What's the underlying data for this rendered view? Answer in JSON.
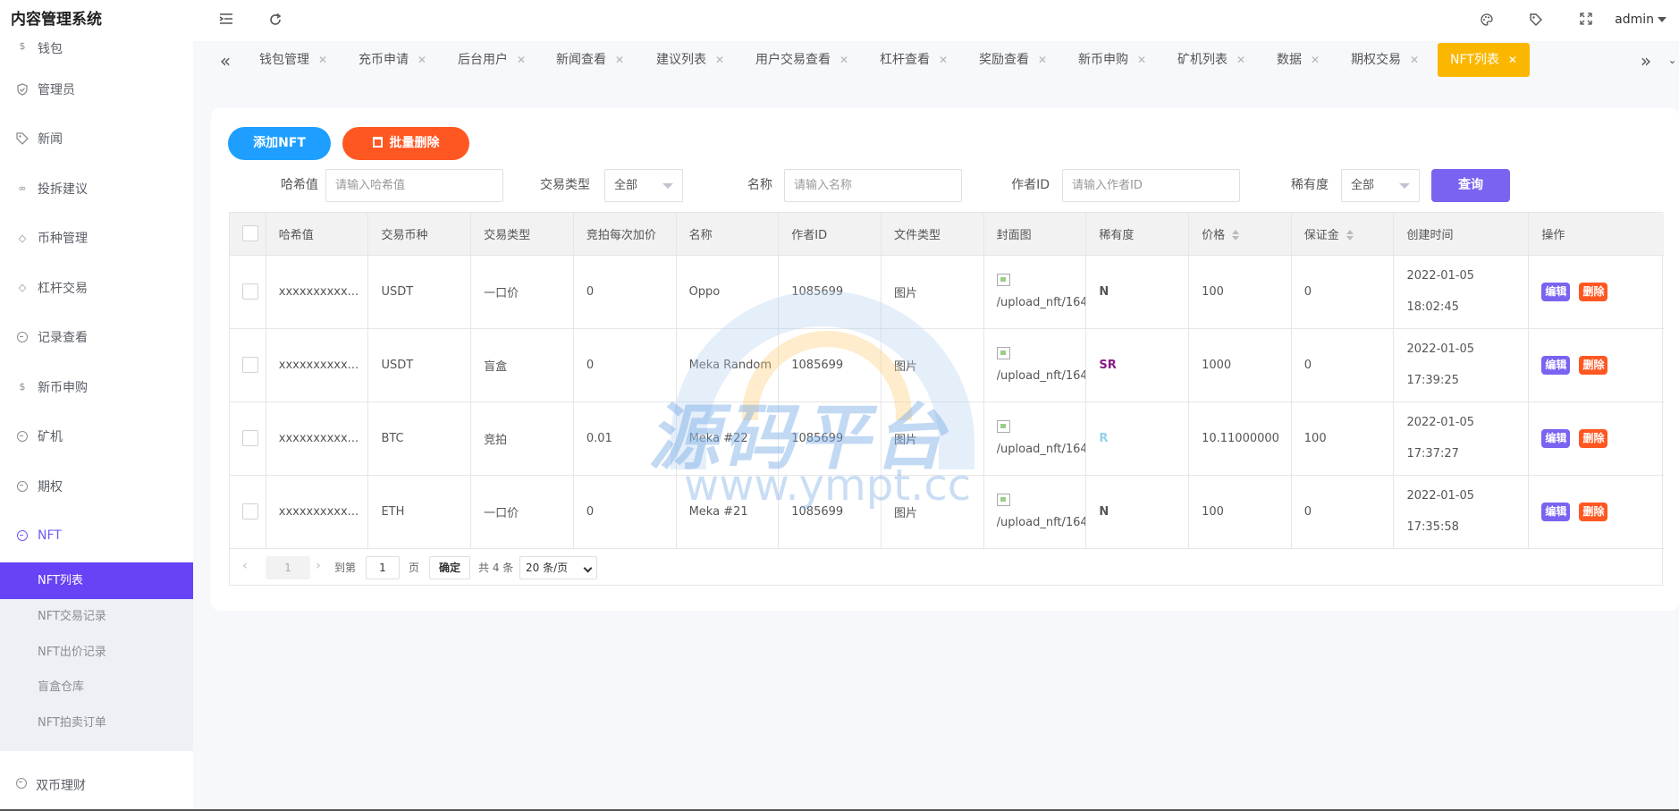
{
  "app": {
    "title": "内容管理系统"
  },
  "header": {
    "user": "admin"
  },
  "sidebar": {
    "items": [
      {
        "label": "钱包",
        "icon": "dollar-circle-icon"
      },
      {
        "label": "管理员",
        "icon": "shield-icon"
      },
      {
        "label": "新闻",
        "icon": "tag-icon"
      },
      {
        "label": "投拆建议",
        "icon": "link-icon"
      },
      {
        "label": "币种管理",
        "icon": "diamond-icon"
      },
      {
        "label": "杠杆交易",
        "icon": "diamond-icon"
      },
      {
        "label": "记录查看",
        "icon": "circle-icon"
      },
      {
        "label": "新币申购",
        "icon": "dollar-circle-icon"
      },
      {
        "label": "矿机",
        "icon": "circle-icon"
      },
      {
        "label": "期权",
        "icon": "circle-icon"
      },
      {
        "label": "NFT",
        "icon": "circle-icon"
      }
    ],
    "submenu": [
      "NFT列表",
      "NFT交易记录",
      "NFT出价记录",
      "盲盒仓库",
      "NFT拍卖订单"
    ],
    "bottom": "双币理财"
  },
  "tabs": [
    "钱包管理",
    "充币申请",
    "后台用户",
    "新闻查看",
    "建议列表",
    "用户交易查看",
    "杠杆查看",
    "奖励查看",
    "新币申购",
    "矿机列表",
    "数据",
    "期权交易",
    "NFT列表"
  ],
  "toolbar": {
    "add": "添加NFT",
    "batch_delete": "批量删除"
  },
  "filters": {
    "hash_label": "哈希值",
    "hash_placeholder": "请输入哈希值",
    "type_label": "交易类型",
    "type_value": "全部",
    "name_label": "名称",
    "name_placeholder": "请输入名称",
    "author_label": "作者ID",
    "author_placeholder": "请输入作者ID",
    "rarity_label": "稀有度",
    "rarity_value": "全部",
    "query": "查询"
  },
  "table": {
    "columns": [
      "哈希值",
      "交易币种",
      "交易类型",
      "竞拍每次加价",
      "名称",
      "作者ID",
      "文件类型",
      "封面图",
      "稀有度",
      "价格",
      "保证金",
      "创建时间",
      "操作"
    ],
    "rows": [
      {
        "hash": "xxxxxxxxxx...",
        "coin": "USDT",
        "type": "一口价",
        "increment": "0",
        "name": "Oppo",
        "author": "1085699",
        "file": "图片",
        "cover": "/upload_nft/16413",
        "rarity": "N",
        "price": "100",
        "deposit": "0",
        "date": "2022-01-05",
        "time": "18:02:45"
      },
      {
        "hash": "xxxxxxxxxx...",
        "coin": "USDT",
        "type": "盲盒",
        "increment": "0",
        "name": "Meka Random",
        "author": "1085699",
        "file": "图片",
        "cover": "/upload_nft/16413",
        "rarity": "SR",
        "price": "1000",
        "deposit": "0",
        "date": "2022-01-05",
        "time": "17:39:25"
      },
      {
        "hash": "xxxxxxxxxx...",
        "coin": "BTC",
        "type": "竞拍",
        "increment": "0.01",
        "name": "Meka #22",
        "author": "1085699",
        "file": "图片",
        "cover": "/upload_nft/16413",
        "rarity": "R",
        "price": "10.11000000",
        "deposit": "100",
        "date": "2022-01-05",
        "time": "17:37:27"
      },
      {
        "hash": "xxxxxxxxxx...",
        "coin": "ETH",
        "type": "一口价",
        "increment": "0",
        "name": "Meka #21",
        "author": "1085699",
        "file": "图片",
        "cover": "/upload_nft/16413",
        "rarity": "N",
        "price": "100",
        "deposit": "0",
        "date": "2022-01-05",
        "time": "17:35:58"
      }
    ],
    "edit": "编辑",
    "delete": "删除"
  },
  "pager": {
    "current": "1",
    "goto": "到第",
    "goto_value": "1",
    "page": "页",
    "confirm": "确定",
    "total": "共 4 条",
    "size": "20 条/页"
  },
  "watermark": {
    "title": "源码平台",
    "url": "www.ympt.cc"
  },
  "colors": {
    "accent": "#6842f5",
    "tab_active": "#fbb700",
    "primary": "#1e9fff",
    "danger": "#ff5722",
    "query": "#7a63f0",
    "rarity_sr": "#8b1a8b",
    "rarity_r": "#8fd3e8"
  }
}
